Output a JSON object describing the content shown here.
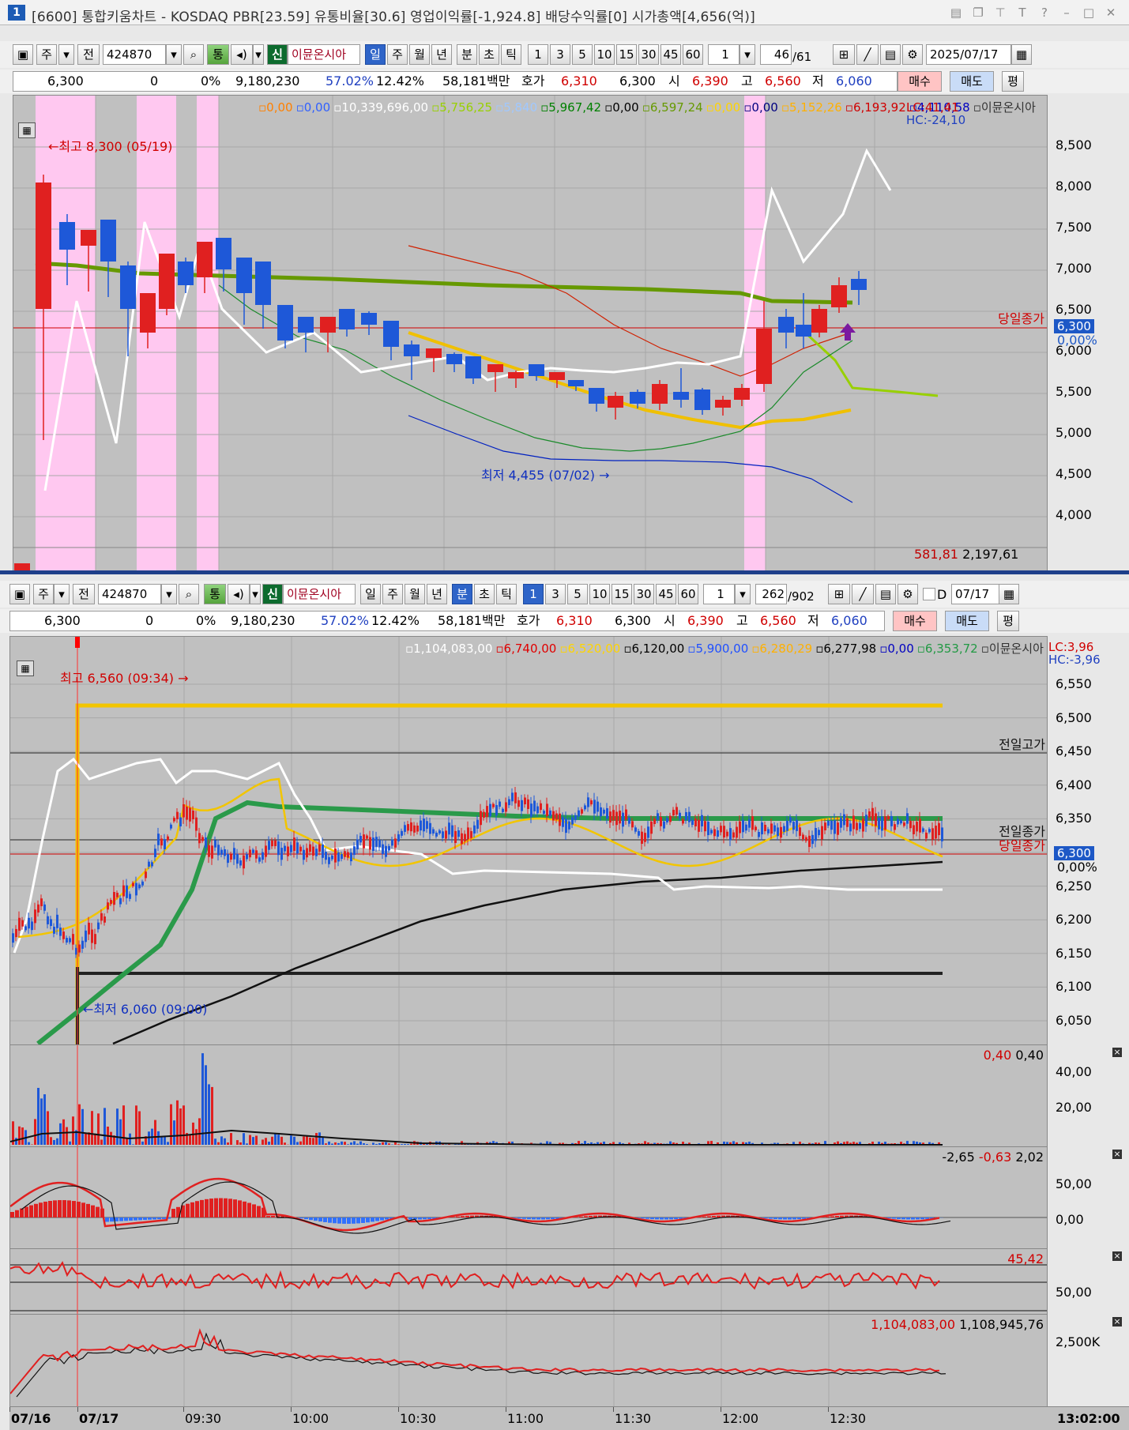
{
  "window": {
    "index": "1",
    "title": "[6600] 통합키움차트 - KOSDAQ PBR[23.59] 유통비율[30.6] 영업이익률[-1,924.8] 배당수익률[0] 시가총액[4,656(억)]"
  },
  "top": {
    "toolbar": {
      "type1": "주",
      "type2": "전",
      "code": "424870",
      "tong": "통",
      "sin": "신",
      "stock_name": "이뮨온시아",
      "periods": [
        "일",
        "주",
        "월",
        "년",
        "분",
        "초",
        "틱"
      ],
      "active_period": "일",
      "intervals": [
        "1",
        "3",
        "5",
        "10",
        "15",
        "30",
        "45",
        "60"
      ],
      "interval_value": "1",
      "count": "46",
      "total": "/61",
      "date": "2025/07/17"
    },
    "quote": {
      "price": "6,300",
      "change": "0",
      "rate": "0%",
      "volume": "9,180,230",
      "turnover": "57.02%",
      "ratio2": "12.42%",
      "amount": "58,181백만",
      "hoga_label": "호가",
      "ask": "6,310",
      "bid": "6,300",
      "open_label": "시",
      "open": "6,390",
      "high_label": "고",
      "high": "6,560",
      "low_label": "저",
      "low": "6,060",
      "buy": "매수",
      "sell": "매도",
      "flat": "평"
    },
    "legend": [
      {
        "text": "0,00",
        "color": "#ff8000"
      },
      {
        "text": "0,00",
        "color": "#3060ff"
      },
      {
        "text": "10,339,696,00",
        "color": "#ffffff"
      },
      {
        "text": "5,756,25",
        "color": "#98d000"
      },
      {
        "text": "5,840",
        "color": "#a0c8ff"
      },
      {
        "text": "5,967,42",
        "color": "#008000"
      },
      {
        "text": "0,00",
        "color": "#000000"
      },
      {
        "text": "6,597,24",
        "color": "#669900"
      },
      {
        "text": "0,00",
        "color": "#ffd400"
      },
      {
        "text": "0,00",
        "color": "#000080"
      },
      {
        "text": "5,152,26",
        "color": "#ffb000"
      },
      {
        "text": "6,193,92",
        "color": "#d00000"
      },
      {
        "text": "4,110,58",
        "color": "#0000c0"
      },
      {
        "text": "이뮨온시아",
        "color": "#333333"
      }
    ],
    "lc": "LC:41,41",
    "hc": "HC:-24,10",
    "y_ticks": [
      "8,500",
      "8,000",
      "7,500",
      "7,000",
      "6,500",
      "6,000",
      "5,500",
      "5,000",
      "4,500",
      "4,000"
    ],
    "high_note": "최고 8,300 (05/19)",
    "low_note": "최저 4,455 (07/02)",
    "close_label": "당일종가",
    "close_price": "6,300",
    "close_pct": "0,00%",
    "vol_note": "581,81",
    "vol_note2": "2,197,61"
  },
  "bottom": {
    "toolbar": {
      "type1": "주",
      "type2": "전",
      "code": "424870",
      "tong": "통",
      "sin": "신",
      "stock_name": "이뮨온시아",
      "periods": [
        "일",
        "주",
        "월",
        "년",
        "분",
        "초",
        "틱"
      ],
      "active_period": "분",
      "intervals": [
        "1",
        "3",
        "5",
        "10",
        "15",
        "30",
        "45",
        "60"
      ],
      "active_interval": "1",
      "interval_value": "1",
      "count": "262",
      "total": "/902",
      "d_label": "D",
      "date": "07/17"
    },
    "quote": {
      "price": "6,300",
      "change": "0",
      "rate": "0%",
      "volume": "9,180,230",
      "turnover": "57.02%",
      "ratio2": "12.42%",
      "amount": "58,181백만",
      "hoga_label": "호가",
      "ask": "6,310",
      "bid": "6,300",
      "open_label": "시",
      "open": "6,390",
      "high_label": "고",
      "high": "6,560",
      "low_label": "저",
      "low": "6,060",
      "buy": "매수",
      "sell": "매도",
      "flat": "평"
    },
    "legend": [
      {
        "text": "1,104,083,00",
        "color": "#ffffff"
      },
      {
        "text": "6,740,00",
        "color": "#e00000"
      },
      {
        "text": "6,520,00",
        "color": "#ffd400"
      },
      {
        "text": "6,120,00",
        "color": "#000000"
      },
      {
        "text": "5,900,00",
        "color": "#2050ff"
      },
      {
        "text": "6,280,29",
        "color": "#ffb000"
      },
      {
        "text": "6,277,98",
        "color": "#000000"
      },
      {
        "text": "0,00",
        "color": "#0000c0"
      },
      {
        "text": "6,353,72",
        "color": "#229944"
      },
      {
        "text": "이뮨온시아",
        "color": "#333333"
      }
    ],
    "lc": "LC:3,96",
    "hc": "HC:-3,96",
    "y_ticks": [
      "6,550",
      "6,500",
      "6,450",
      "6,400",
      "6,350",
      "6,300",
      "6,250",
      "6,200",
      "6,150",
      "6,100",
      "6,050"
    ],
    "high_note": "최고 6,560 (09:34)",
    "low_note": "최저 6,060 (09:00)",
    "prev_high_label": "전일고가",
    "prev_close_label": "전일종가",
    "close_label": "당일종가",
    "close_price": "6,300",
    "close_pct": "0,00%",
    "volume_panel": {
      "legend1": "0,40",
      "legend2": "0,40",
      "ticks": [
        "40,00",
        "20,00"
      ]
    },
    "macd_panel": {
      "legend1": "-2,65",
      "legend2": "-0,63",
      "legend3": "2,02",
      "ticks": [
        "50,00",
        "0,00"
      ]
    },
    "rsi_panel": {
      "legend1": "45,42",
      "ticks": [
        "50,00"
      ]
    },
    "obv_panel": {
      "legend1": "1,104,083,00",
      "legend2": "1,108,945,76",
      "ticks": [
        "2,500K"
      ]
    },
    "x_labels": [
      "07/16",
      "07/17",
      "09:30",
      "10:00",
      "10:30",
      "11:00",
      "11:30",
      "12:00",
      "12:30"
    ],
    "time_readout": "13:02:00"
  }
}
